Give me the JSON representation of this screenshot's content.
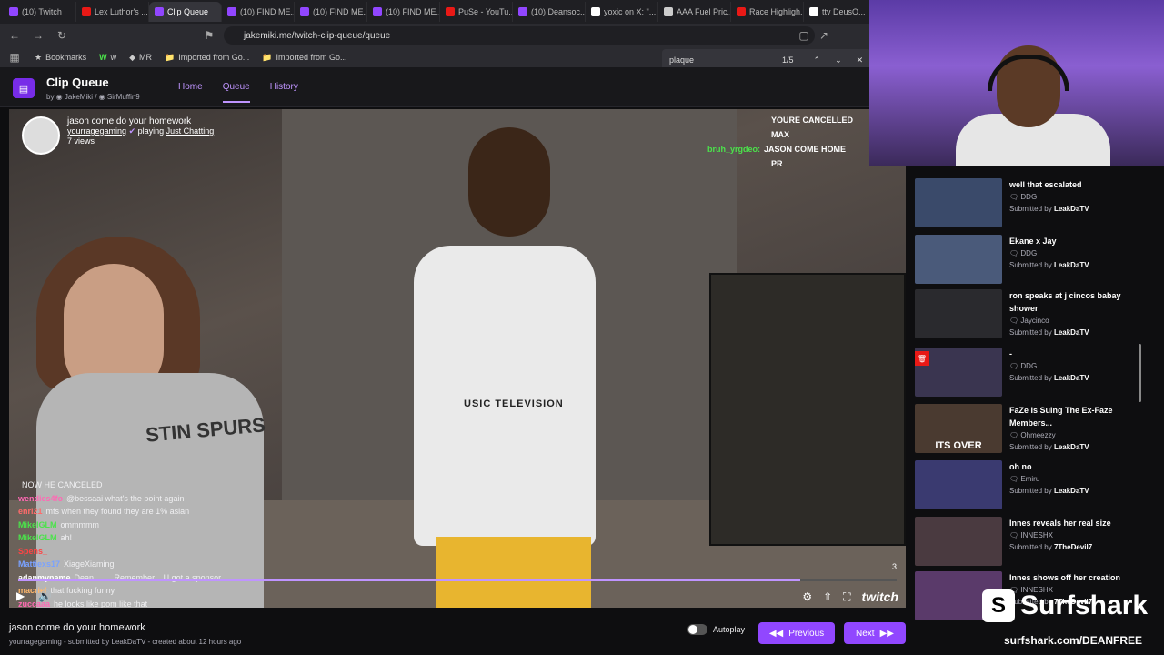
{
  "tabs": [
    {
      "label": "(10) Twitch",
      "color": "#9146ff"
    },
    {
      "label": "Lex Luthor's ...",
      "color": "#e91916"
    },
    {
      "label": "Clip Queue",
      "color": "#9146ff"
    },
    {
      "label": "(10) FIND ME...",
      "color": "#9146ff"
    },
    {
      "label": "(10) FIND ME...",
      "color": "#9146ff"
    },
    {
      "label": "(10) FIND ME...",
      "color": "#9146ff"
    },
    {
      "label": "PuSe - YouTu...",
      "color": "#e91916"
    },
    {
      "label": "(10) Deansoc...",
      "color": "#9146ff"
    },
    {
      "label": "yoxic on X: \"...",
      "color": "#ffffff"
    },
    {
      "label": "AAA Fuel Pric...",
      "color": "#cccccc"
    },
    {
      "label": "Race Highligh...",
      "color": "#e91916"
    },
    {
      "label": "ttv DeusO...",
      "color": "#ffffff"
    }
  ],
  "url": "jakemiki.me/twitch-clip-queue/queue",
  "bookmarks": [
    "Bookmarks",
    "w",
    "MR",
    "Imported from Go...",
    "Imported from Go..."
  ],
  "find": {
    "query": "plaque",
    "count": "1/5"
  },
  "app": {
    "title": "Clip Queue",
    "by": "by",
    "author1": "JakeMiki",
    "author2": "SirMuffin9",
    "nav": [
      "Home",
      "Queue",
      "History"
    ]
  },
  "clip": {
    "title": "jason come do your homework",
    "channel": "yourragegaming",
    "playing": "playing",
    "game": "Just Chatting",
    "views": "7 views",
    "shirt_text": "USIC TELEVISION",
    "spurs": "STIN SPURS",
    "quality": "3"
  },
  "top_chat": [
    {
      "user": "",
      "text": "YOURE CANCELLED",
      "color": "#ff6b6b"
    },
    {
      "user": "",
      "text": "MAX",
      "color": "#ffb86c"
    },
    {
      "user": "bruh_yrgdeo:",
      "text": "JASON COME HOME",
      "color": "#4be34b"
    },
    {
      "user": "",
      "text": "PR",
      "color": "#7aa2ff"
    }
  ],
  "overlay_chat": [
    {
      "user": "",
      "text": "NOW HE CANCELED",
      "color": "#9147ff"
    },
    {
      "user": "wendies4fo",
      "text": "@bessaai what's the point again",
      "color": "#ff69b4"
    },
    {
      "user": "enri21",
      "text": "mfs when they found they are 1% asian",
      "color": "#ff6b6b"
    },
    {
      "user": "MikelGLM",
      "text": "ommmmm",
      "color": "#4be34b"
    },
    {
      "user": "MikelGLM",
      "text": "ah!",
      "color": "#4be34b"
    },
    {
      "user": "Spens_",
      "text": "",
      "color": "#ff4444"
    },
    {
      "user": "Mattiexs17",
      "text": "XiageXiaming",
      "color": "#7aa2ff"
    },
    {
      "user": "adanmyname",
      "text": "Dean........ Remember... U got a sponsor",
      "color": "#ffffff"
    },
    {
      "user": "macriel",
      "text": "that fucking funny",
      "color": "#ffb86c"
    },
    {
      "user": "zuccaaa",
      "text": "he looks like pom like that",
      "color": "#ff69b4"
    }
  ],
  "bottom": {
    "title": "jason come do your homework",
    "meta": "yourragegaming - submitted by LeakDaTV - created about 12 hours ago",
    "autoplay": "Autoplay",
    "previous": "Previous",
    "next": "Next"
  },
  "queue": [
    {
      "title": "well that escalated",
      "channel": "DDG",
      "submitted": "Submitted by",
      "by": "LeakDaTV",
      "thumb": "#3a4a6a"
    },
    {
      "title": "Ekane x Jay",
      "channel": "DDG",
      "submitted": "Submitted by",
      "by": "LeakDaTV",
      "thumb": "#4a5a7a"
    },
    {
      "title": "ron speaks at j cincos babay shower",
      "channel": "Jaycinco",
      "submitted": "Submitted by",
      "by": "LeakDaTV",
      "thumb": "#2a2a2e"
    },
    {
      "title": "-",
      "channel": "DDG",
      "submitted": "Submitted by",
      "by": "LeakDaTV",
      "thumb": "#3a3550"
    },
    {
      "title": "FaZe Is Suing The Ex-Faze Members...",
      "channel": "Ohmeezzy",
      "submitted": "Submitted by",
      "by": "LeakDaTV",
      "thumb": "#4a3a30",
      "overlay": "ITS OVER"
    },
    {
      "title": "oh no",
      "channel": "Emiru",
      "submitted": "Submitted by",
      "by": "LeakDaTV",
      "thumb": "#3a3a70"
    },
    {
      "title": "Innes reveals her real size",
      "channel": "INNESHX",
      "submitted": "Submitted by",
      "by": "7TheDevil7",
      "thumb": "#4a3a40"
    },
    {
      "title": "Innes shows off her creation",
      "channel": "INNESHX",
      "submitted": "Submitted by",
      "by": "7TheDevil7",
      "thumb": "#5a3a6a"
    }
  ],
  "sponsor": {
    "name": "Surfshark",
    "url": "surfshark.com/DEANFREE"
  }
}
